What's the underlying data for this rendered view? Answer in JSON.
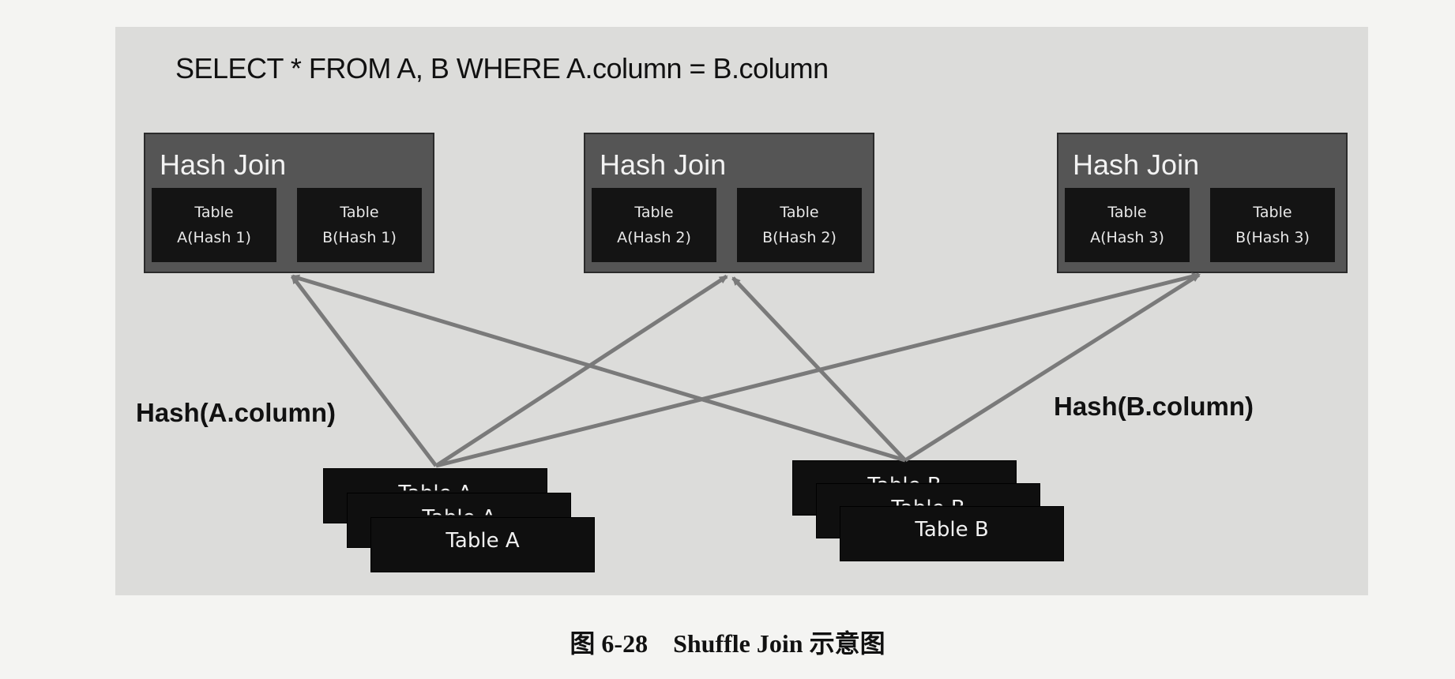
{
  "query": "SELECT * FROM A, B WHERE A.column = B.column",
  "hash_joins": [
    {
      "title": "Hash Join",
      "left_line1": "Table",
      "left_line2": "A(Hash 1)",
      "right_line1": "Table",
      "right_line2": "B(Hash 1)"
    },
    {
      "title": "Hash Join",
      "left_line1": "Table",
      "left_line2": "A(Hash 2)",
      "right_line1": "Table",
      "right_line2": "B(Hash 2)"
    },
    {
      "title": "Hash Join",
      "left_line1": "Table",
      "left_line2": "A(Hash 3)",
      "right_line1": "Table",
      "right_line2": "B(Hash 3)"
    }
  ],
  "hash_a_label": "Hash(A.column)",
  "hash_b_label": "Hash(B.column)",
  "table_a_label": "Table A",
  "table_b_label": "Table B",
  "caption": "图 6-28    Shuffle Join 示意图",
  "colors": {
    "arrow": "#7a7a7a",
    "join_box": "#555555",
    "sub_box": "#141414"
  }
}
